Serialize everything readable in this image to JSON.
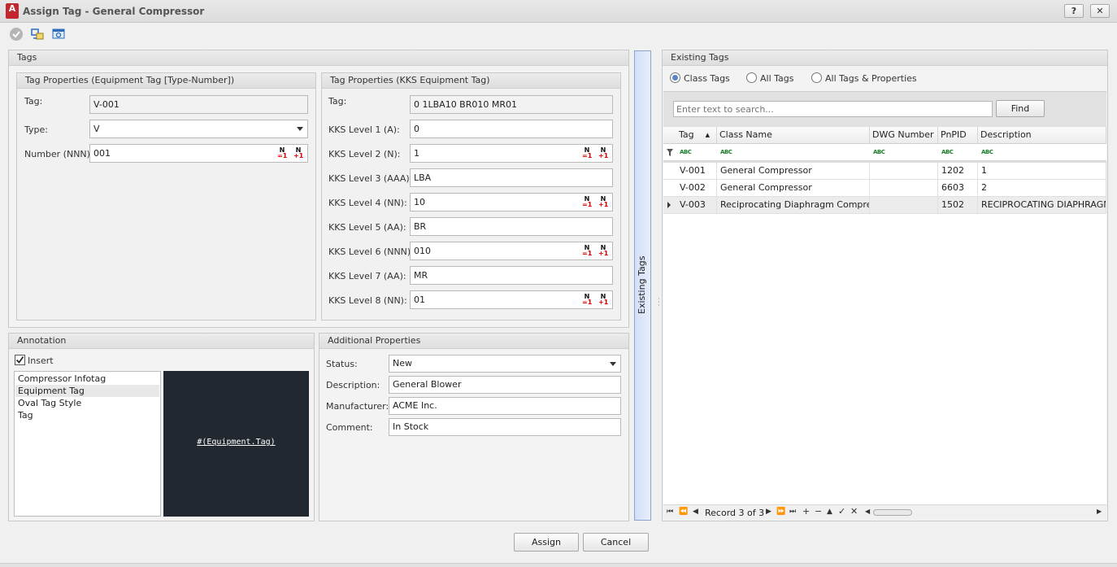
{
  "window": {
    "title": "Assign Tag - General Compressor",
    "app_icon": "A",
    "help": "?",
    "close": "✕"
  },
  "tags_panel": {
    "title": "Tags",
    "equipment": {
      "title": "Tag Properties (Equipment Tag [Type-Number])",
      "tag_label": "Tag:",
      "tag_value": "V-001",
      "type_label": "Type:",
      "type_value": "V",
      "number_label": "Number (NNN):",
      "number_value": "001"
    },
    "kks": {
      "title": "Tag Properties (KKS Equipment Tag)",
      "tag_label": "Tag:",
      "tag_value": "0 1LBA10 BR010 MR01",
      "levels": [
        {
          "label": "KKS Level 1 (A):",
          "value": "0"
        },
        {
          "label": "KKS Level 2 (N):",
          "value": "1"
        },
        {
          "label": "KKS Level 3 (AAA):",
          "value": "LBA"
        },
        {
          "label": "KKS Level 4 (NN):",
          "value": "10"
        },
        {
          "label": "KKS Level 5 (AA):",
          "value": "BR"
        },
        {
          "label": "KKS Level 6 (NNN):",
          "value": "010"
        },
        {
          "label": "KKS Level 7 (AA):",
          "value": "MR"
        },
        {
          "label": "KKS Level 8 (NN):",
          "value": "01"
        }
      ]
    },
    "stepper": {
      "n": "N",
      "minus": "=1",
      "plus": "+1"
    }
  },
  "annotation": {
    "title": "Annotation",
    "insert_label": "Insert",
    "insert_checked": true,
    "styles": [
      "Compressor Infotag",
      "Equipment Tag",
      "Oval Tag Style",
      "Tag"
    ],
    "selected_style": "Equipment Tag",
    "preview_text": "#(Equipment.Tag)"
  },
  "additional": {
    "title": "Additional Properties",
    "status_label": "Status:",
    "status_value": "New",
    "description_label": "Description:",
    "description_value": "General Blower",
    "manufacturer_label": "Manufacturer:",
    "manufacturer_value": "ACME Inc.",
    "comment_label": "Comment:",
    "comment_value": "In Stock"
  },
  "splitter_label": "Existing Tags",
  "existing": {
    "title": "Existing Tags",
    "radios": [
      {
        "label": "Class Tags",
        "checked": true
      },
      {
        "label": "All Tags",
        "checked": false
      },
      {
        "label": "All Tags & Properties",
        "checked": false
      }
    ],
    "search_placeholder": "Enter text to search...",
    "find_label": "Find",
    "columns": [
      "Tag",
      "Class Name",
      "DWG Number",
      "PnPID",
      "Description"
    ],
    "filter_icon_text": "ABC",
    "rows": [
      {
        "tag": "V-001",
        "class_name": "General Compressor",
        "dwg": "",
        "pnpid": "1202",
        "description": "1"
      },
      {
        "tag": "V-002",
        "class_name": "General Compressor",
        "dwg": "",
        "pnpid": "6603",
        "description": "2"
      },
      {
        "tag": "V-003",
        "class_name": "Reciprocating Diaphragm Compressor",
        "dwg": "",
        "pnpid": "1502",
        "description": "RECIPROCATING DIAPHRAGM C"
      }
    ],
    "record_text": "Record 3 of 3"
  },
  "buttons": {
    "assign": "Assign",
    "cancel": "Cancel"
  }
}
